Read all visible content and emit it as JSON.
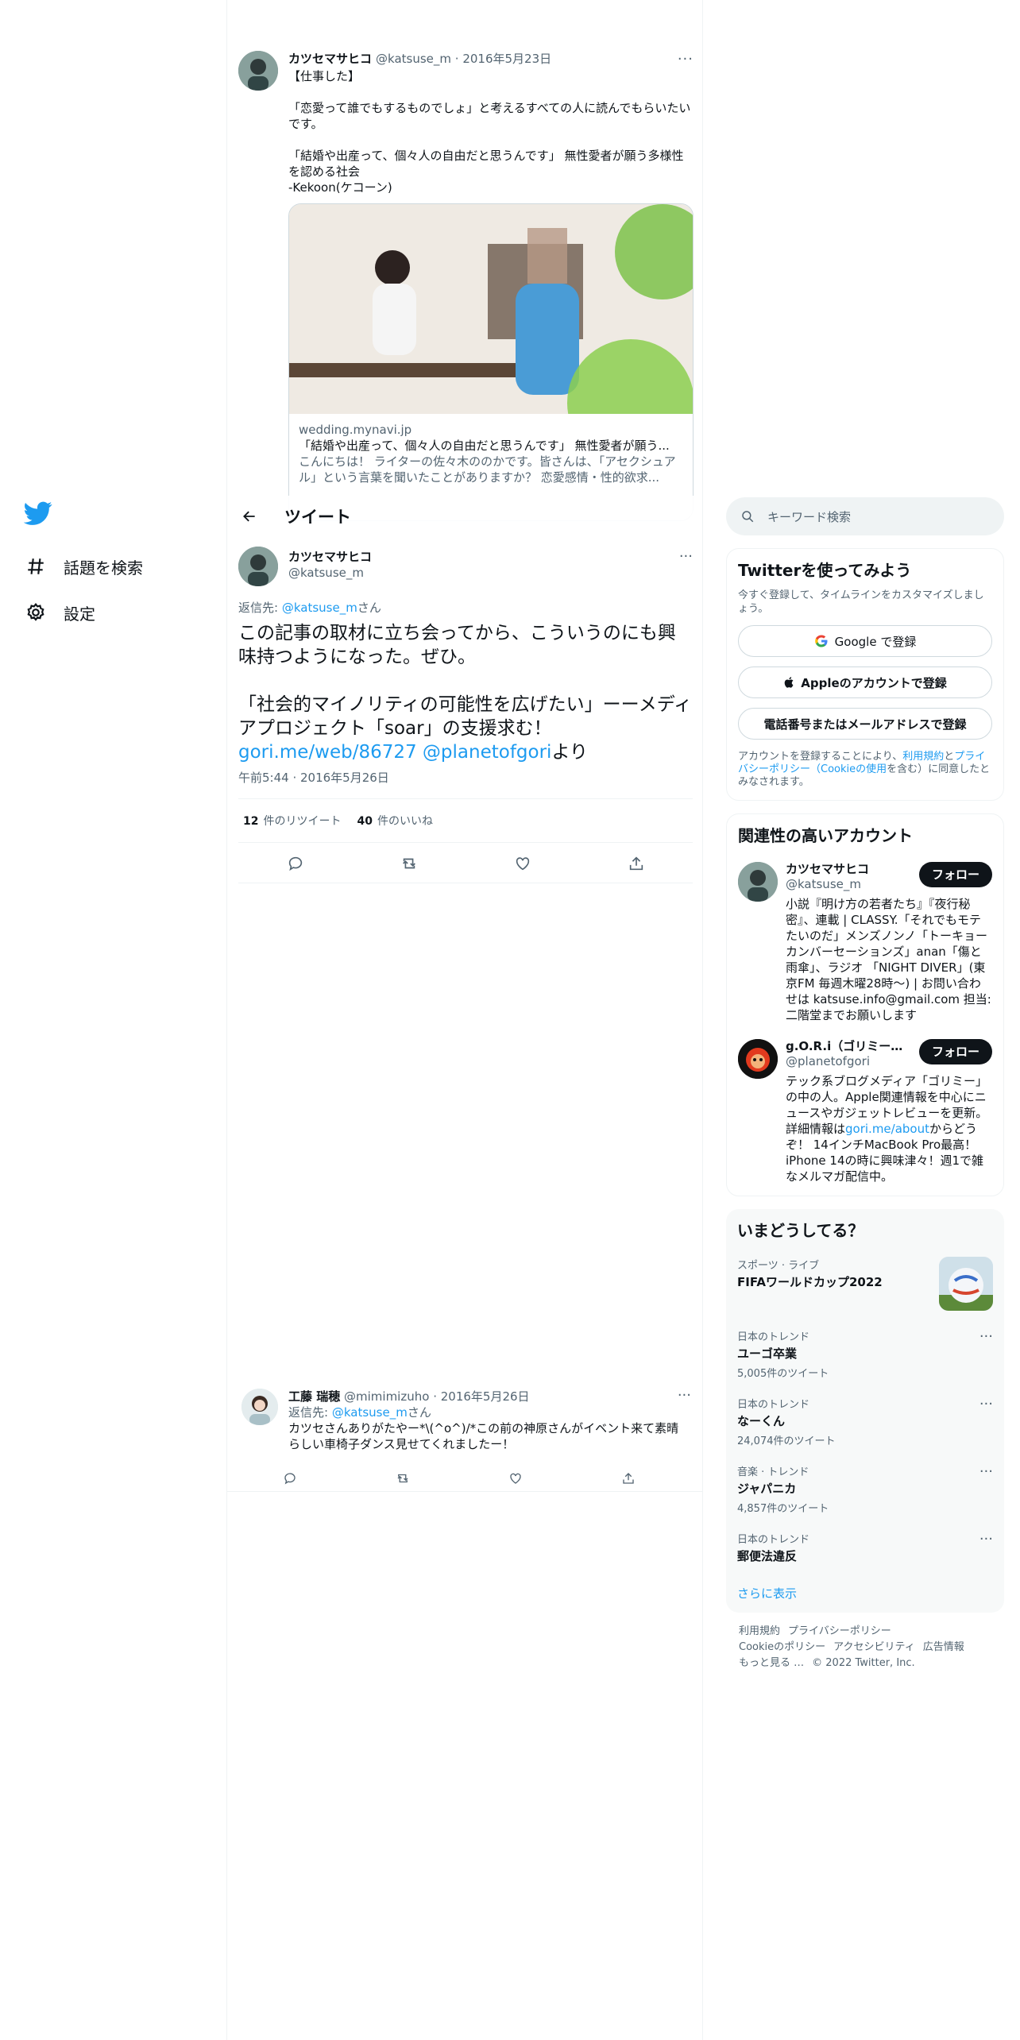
{
  "nav": {
    "items": [
      {
        "label": "話題を検索",
        "icon": "hashtag-icon"
      },
      {
        "label": "設定",
        "icon": "gear-icon"
      }
    ]
  },
  "quoted_tweet": {
    "name": "カツセマサヒコ",
    "handle": "@katsuse_m",
    "date": "· 2016年5月23日",
    "text": "【仕事した】\n\n「恋愛って誰でもするものでしょ」と考えるすべての人に読んでもらいたいです。\n\n「結婚や出産って、個々人の自由だと思うんです」 無性愛者が願う多様性を認める社会\n-Kekoon(ケコーン)",
    "card": {
      "domain": "wedding.mynavi.jp",
      "title": "「結婚や出産って、個々人の自由だと思うんです」 無性愛者が願う...",
      "desc": "こんにちは！ ライターの佐々木ののかです。皆さんは、「アセクシュアル」という言葉を聞いたことがありますか？ 恋愛感情・性的欲求..."
    }
  },
  "header": {
    "title": "ツイート"
  },
  "main_tweet": {
    "name": "カツセマサヒコ",
    "handle": "@katsuse_m",
    "reply_prefix": "返信先: ",
    "reply_handle": "@katsuse_m",
    "reply_suffix": "さん",
    "line1": "この記事の取材に立ち会ってから、こういうのにも興味持つようになった。ぜひ。",
    "line2": "「社会的マイノリティの可能性を広げたい」ーーメディアプロジェクト「soar」の支援求む！",
    "link1": "gori.me/web/86727",
    "link2": "@planetofgori",
    "line3_suffix": "より",
    "time": "午前5:44 · 2016年5月26日",
    "retweets": "12",
    "retweets_label": "件のリツイート",
    "likes": "40",
    "likes_label": "件のいいね"
  },
  "reply_tweet": {
    "name": "工藤 瑞穂",
    "handle": "@mimimizuho",
    "date": "· 2016年5月26日",
    "reply_prefix": "返信先: ",
    "reply_handle": "@katsuse_m",
    "reply_suffix": "さん",
    "text": "カツセさんありがたやー*\\(^o^)/*この前の神原さんがイベント来て素晴らしい車椅子ダンス見せてくれましたー！"
  },
  "sidebar": {
    "search_placeholder": "キーワード検索",
    "signup": {
      "title": "Twitterを使ってみよう",
      "sub": "今すぐ登録して、タイムラインをカスタマイズしましょう。",
      "google": "Google で登録",
      "apple": "Appleのアカウントで登録",
      "phone": "電話番号またはメールアドレスで登録",
      "legal_1": "アカウントを登録することにより、",
      "legal_terms": "利用規約",
      "legal_2": "と",
      "legal_privacy": "プライバシーポリシー（Cookieの使用",
      "legal_3": "を含む）に同意したとみなされます。"
    },
    "related": {
      "title": "関連性の高いアカウント",
      "accounts": [
        {
          "name": "カツセマサヒコ",
          "handle": "@katsuse_m",
          "follow": "フォロー",
          "bio": "小説『明け方の若者たち』『夜行秘密』、連載 | CLASSY.「それでもモテたいのだ」メンズノンノ「トーキョーカンバーセーションズ」anan「傷と雨傘」、ラジオ 「NIGHT DIVER」(東京FM 毎週木曜28時〜) | お問い合わせは katsuse.info@gmail.com 担当:二階堂までお願いします"
        },
        {
          "name": "g.O.R.i（ゴリミー管理人）",
          "handle": "@planetofgori",
          "follow": "フォロー",
          "bio_1": "テック系ブログメディア「ゴリミー」の中の人。Apple関連情報を中心にニュースやガジェットレビューを更新。詳細情報は",
          "bio_link": "gori.me/about",
          "bio_2": "からどうぞ！ 14インチMacBook Pro最高！iPhone 14の時に興味津々！週1で雑なメルマガ配信中。"
        }
      ]
    },
    "trends": {
      "title": "いまどうしてる？",
      "items": [
        {
          "context": "スポーツ · ライブ",
          "name": "FIFAワールドカップ2022",
          "count": ""
        },
        {
          "context": "日本のトレンド",
          "name": "ユーゴ卒業",
          "count": "5,005件のツイート"
        },
        {
          "context": "日本のトレンド",
          "name": "なーくん",
          "count": "24,074件のツイート"
        },
        {
          "context": "音楽 · トレンド",
          "name": "ジャパニカ",
          "count": "4,857件のツイート"
        },
        {
          "context": "日本のトレンド",
          "name": "郵便法違反",
          "count": ""
        }
      ],
      "show_more": "さらに表示"
    },
    "footer": {
      "terms": "利用規約",
      "privacy": "プライバシーポリシー",
      "cookie": "Cookieのポリシー",
      "access": "アクセシビリティ",
      "ads": "広告情報",
      "more": "もっと見る …",
      "copyright": "© 2022 Twitter, Inc."
    }
  },
  "colors": {
    "accent": "#1d9bf0",
    "text": "#0f1419",
    "muted": "#536471",
    "border": "#eff3f4"
  }
}
